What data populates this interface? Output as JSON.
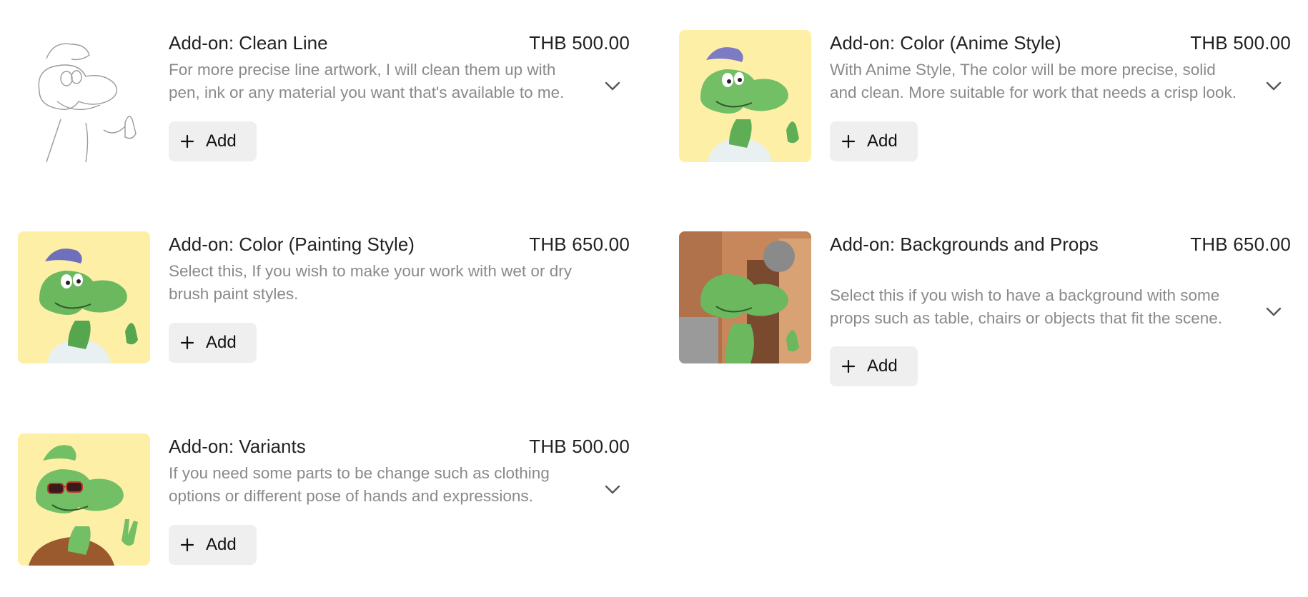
{
  "addons": [
    {
      "title": "Add-on: Clean Line",
      "price": "THB 500.00",
      "description": "For more precise line artwork, I will clean them up with pen, ink or any material you want that's available to me.",
      "add_label": "Add",
      "thumb_icon": "lineart-character-thumbnail",
      "thumb_bg": "#ffffff",
      "expandable": true
    },
    {
      "title": "Add-on: Color (Anime Style)",
      "price": "THB 500.00",
      "description": "With Anime Style, The color will be more precise, solid and clean. More suitable for work that needs a crisp look.",
      "add_label": "Add",
      "thumb_icon": "anime-color-character-thumbnail",
      "thumb_bg": "#fdf0a6",
      "expandable": true
    },
    {
      "title": "Add-on: Color (Painting Style)",
      "price": "THB 650.00",
      "description": "Select this, If you wish to make your work with wet or dry brush paint styles.",
      "add_label": "Add",
      "thumb_icon": "painted-character-thumbnail",
      "thumb_bg": "#fdf0a6",
      "expandable": false
    },
    {
      "title": "Add-on: Backgrounds and Props",
      "price": "THB 650.00",
      "description": "Select this if you wish to have a background with some props such as table, chairs or objects that fit the scene.",
      "add_label": "Add",
      "thumb_icon": "background-props-character-thumbnail",
      "thumb_bg": "#c8875a",
      "expandable": true
    },
    {
      "title": "Add-on: Variants",
      "price": "THB 500.00",
      "description": "If you need some parts to be change such as clothing options or different pose of hands and expressions.",
      "add_label": "Add",
      "thumb_icon": "variant-character-thumbnail",
      "thumb_bg": "#fdf0a6",
      "expandable": true
    }
  ]
}
